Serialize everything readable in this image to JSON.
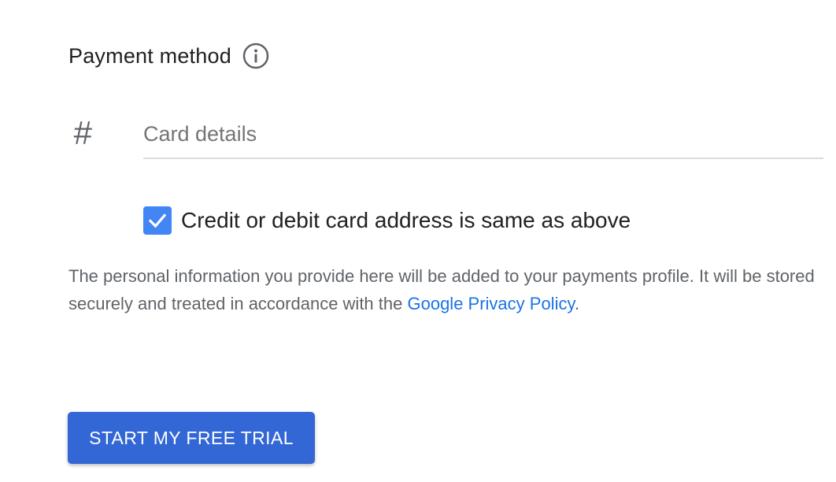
{
  "payment": {
    "title": "Payment method",
    "info_icon": "info-circle-icon",
    "card_field": {
      "icon": "hash-icon",
      "icon_glyph": "#",
      "placeholder": "Card details",
      "value": ""
    },
    "same_address": {
      "checked": true,
      "label": "Credit or debit card address is same as above"
    },
    "notice": {
      "text": "The personal information you provide here will be added to your payments profile. It will be stored securely and treated in accordance with the ",
      "link_text": "Google Privacy Policy",
      "suffix": "."
    }
  },
  "actions": {
    "start_trial_label": "START MY FREE TRIAL"
  },
  "colors": {
    "primary_button": "#3367d6",
    "checkbox": "#4285f4",
    "link": "#1a73e8"
  }
}
